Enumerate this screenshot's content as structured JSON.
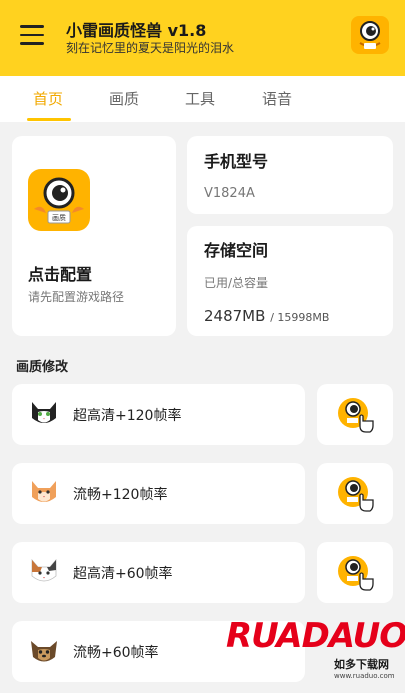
{
  "header": {
    "title": "小雷画质怪兽 v1.8",
    "subtitle": "刻在记忆里的夏天是阳光的泪水",
    "logo_icon": "monster-logo-icon",
    "menu_icon": "hamburger-menu-icon",
    "background": "#ffd21f"
  },
  "tabs": [
    {
      "label": "首页",
      "active": true
    },
    {
      "label": "画质",
      "active": false
    },
    {
      "label": "工具",
      "active": false
    },
    {
      "label": "语音",
      "active": false
    }
  ],
  "config_card": {
    "title": "点击配置",
    "subtitle": "请先配置游戏路径",
    "logo_text": "画质"
  },
  "device": {
    "title": "手机型号",
    "model": "V1824A"
  },
  "storage": {
    "title": "存储空间",
    "label": "已用/总容量",
    "used": "2487MB",
    "total": "/ 15998MB"
  },
  "section": {
    "title": "画质修改"
  },
  "options": [
    {
      "label": "超高清+120帧率",
      "icon": "black-white-cat-icon"
    },
    {
      "label": "流畅+120帧率",
      "icon": "orange-cat-icon"
    },
    {
      "label": "超高清+60帧率",
      "icon": "calico-cat-icon"
    },
    {
      "label": "流畅+60帧率",
      "icon": "yorkie-dog-icon"
    }
  ],
  "action_icon": "monster-tap-hand-icon",
  "accent_color": "#f2a900",
  "watermark": {
    "brand": "RUADAUO",
    "cn": "如多下载网",
    "url": "www.ruaduo.com"
  }
}
